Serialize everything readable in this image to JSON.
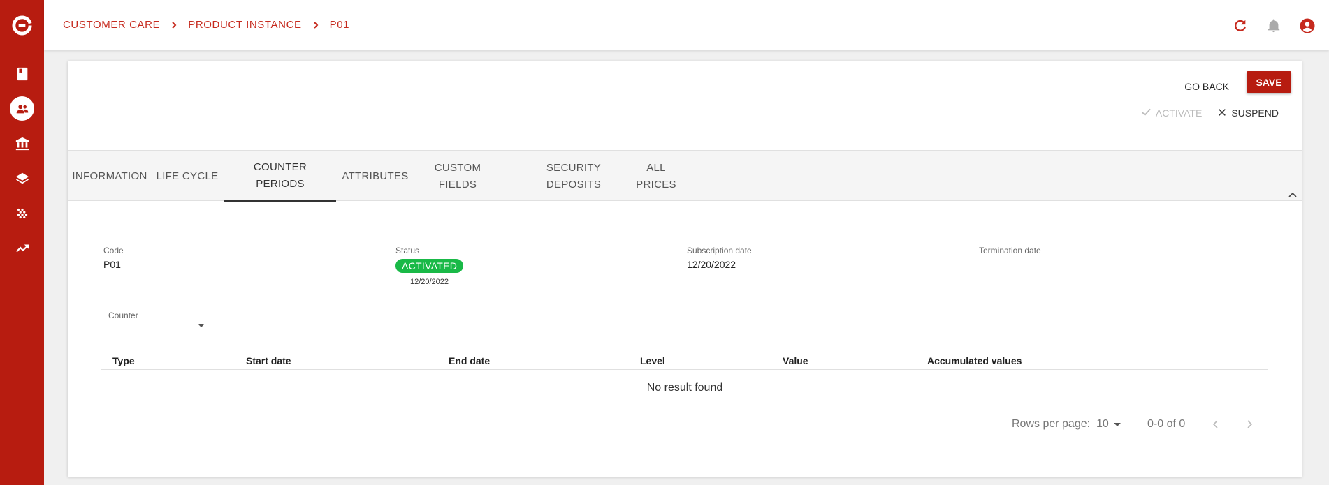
{
  "breadcrumb": {
    "items": [
      "CUSTOMER CARE",
      "PRODUCT INSTANCE",
      "P01"
    ]
  },
  "actions": {
    "go_back": "GO BACK",
    "save": "SAVE",
    "activate": "ACTIVATE",
    "suspend": "SUSPEND"
  },
  "tabs": [
    {
      "line1": "INFORMATION",
      "line2": ""
    },
    {
      "line1": "LIFE CYCLE",
      "line2": ""
    },
    {
      "line1": "COUNTER",
      "line2": "PERIODS"
    },
    {
      "line1": "ATTRIBUTES",
      "line2": ""
    },
    {
      "line1": "CUSTOM FIELDS",
      "line2": ""
    },
    {
      "line1": "SECURITY",
      "line2": "DEPOSITS"
    },
    {
      "line1": "ALL PRICES",
      "line2": ""
    }
  ],
  "active_tab": "COUNTER PERIODS",
  "info": {
    "code_label": "Code",
    "code_value": "P01",
    "status_label": "Status",
    "status_value": "ACTIVATED",
    "status_date": "12/20/2022",
    "subscription_label": "Subscription date",
    "subscription_value": "12/20/2022",
    "termination_label": "Termination date",
    "termination_value": ""
  },
  "counter": {
    "label": "Counter",
    "value": ""
  },
  "table": {
    "columns": [
      "Type",
      "Start date",
      "End date",
      "Level",
      "Value",
      "Accumulated values"
    ],
    "rows": [],
    "empty_text": "No result found"
  },
  "pagination": {
    "rows_per_page_label": "Rows per page:",
    "rows_per_page_value": "10",
    "range_text": "0-0 of 0"
  },
  "colors": {
    "brand": "#b71c10",
    "status_active": "#19b947"
  },
  "icons": {
    "sidebar": [
      "logo-icon",
      "book-icon",
      "customers-icon",
      "bank-icon",
      "layers-icon",
      "dots-grid-icon",
      "trending-up-icon"
    ],
    "header": [
      "refresh-icon",
      "bell-icon",
      "account-icon"
    ]
  }
}
